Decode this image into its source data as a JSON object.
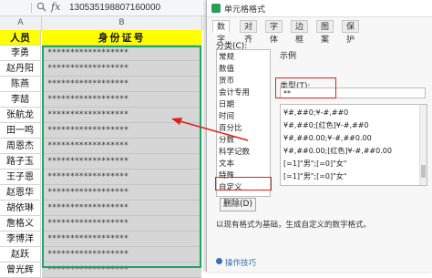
{
  "formula_bar": {
    "zoom_icon": "zoom-icon",
    "fx": "fx",
    "value": "130535198807160000"
  },
  "columns": [
    "A",
    "B"
  ],
  "header": {
    "col_a": "人员",
    "col_b": "身份证号"
  },
  "rows": [
    {
      "name": "李勇",
      "id": "******************"
    },
    {
      "name": "赵丹阳",
      "id": "******************"
    },
    {
      "name": "陈燕",
      "id": "******************"
    },
    {
      "name": "李喆",
      "id": "******************"
    },
    {
      "name": "张航龙",
      "id": "******************"
    },
    {
      "name": "田一鸣",
      "id": "******************"
    },
    {
      "name": "周恩杰",
      "id": "******************"
    },
    {
      "name": "路子玉",
      "id": "******************"
    },
    {
      "name": "王子恩",
      "id": "******************"
    },
    {
      "name": "赵恩华",
      "id": "******************"
    },
    {
      "name": "胡依琳",
      "id": "******************"
    },
    {
      "name": "詹格义",
      "id": "******************"
    },
    {
      "name": "李博洋",
      "id": "******************"
    },
    {
      "name": "赵跃",
      "id": "******************"
    },
    {
      "name": "曾光辉",
      "id": "******************"
    }
  ],
  "dialog": {
    "title": "单元格格式",
    "tabs": [
      "数字",
      "对齐",
      "字体",
      "边框",
      "图案",
      "保护"
    ],
    "category_label": "分类(C):",
    "categories": [
      "常规",
      "数值",
      "货币",
      "会计专用",
      "日期",
      "时间",
      "百分比",
      "分数",
      "科学记数",
      "文本",
      "特殊",
      "自定义"
    ],
    "selected_category": "自定义",
    "sample_label": "示例",
    "type_label": "类型(T):",
    "type_value": "**",
    "format_list": [
      "¥#,##0;¥-#,##0",
      "¥#,##0;[红色]¥-#,##0",
      "¥#,##0.00;¥-#,##0.00",
      "¥#,##0.00;[红色]¥-#,##0.00",
      "[=1]\"男\";[=0]\"女\"",
      "[=1]\"男\";[=0]\"女\""
    ],
    "delete_button": "删除(D)",
    "description": "以现有格式为基础，生成自定义的数字格式。",
    "tips": "操作技巧"
  },
  "colors": {
    "header_fill": "#ffff00",
    "id_fill": "#d6d6d6",
    "selection": "#21a366",
    "highlight": "#e02020"
  }
}
